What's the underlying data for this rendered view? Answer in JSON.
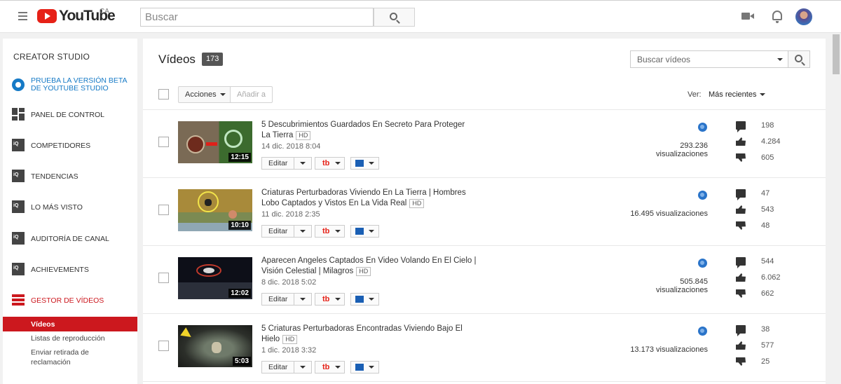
{
  "header": {
    "logo_text": "YouTube",
    "region": "CA",
    "search_placeholder": "Buscar"
  },
  "sidebar": {
    "title": "CREATOR STUDIO",
    "beta_line1": "PRUEBA LA VERSIÓN BETA",
    "beta_line2": "DE YOUTUBE STUDIO",
    "items": [
      {
        "label": "PANEL DE CONTROL",
        "icon": "dashboard-icon"
      },
      {
        "label": "COMPETIDORES",
        "icon": "iq-icon"
      },
      {
        "label": "TENDENCIAS",
        "icon": "iq-icon"
      },
      {
        "label": "LO MÁS VISTO",
        "icon": "iq-icon"
      },
      {
        "label": "AUDITORÍA DE CANAL",
        "icon": "iq-icon"
      },
      {
        "label": "ACHIEVEMENTS",
        "icon": "iq-icon"
      },
      {
        "label": "GESTOR DE VÍDEOS",
        "icon": "video-manager-icon"
      }
    ],
    "sub_items": [
      "Vídeos",
      "Listas de reproducción",
      "Enviar retirada de",
      "reclamación"
    ]
  },
  "main": {
    "title": "Vídeos",
    "count": "173",
    "search_placeholder": "Buscar vídeos",
    "actions_label": "Acciones",
    "add_to_label": "Añadir a",
    "sort_label": "Ver:",
    "sort_value": "Más recientes",
    "edit_label": "Editar",
    "tb_label": "tb",
    "videos": [
      {
        "title_line1": "5 Descubrimientos Guardados En Secreto Para Proteger",
        "title_line2": "La Tierra",
        "hd": "HD",
        "date": "14 dic. 2018 8:04",
        "duration": "12:15",
        "views": "293.236 visualizaciones",
        "comments": "198",
        "likes": "4.284",
        "dislikes": "605"
      },
      {
        "title_line1": "Criaturas Perturbadoras Viviendo En La Tierra | Hombres",
        "title_line2": "Lobo Captados y Vistos En La Vida Real",
        "hd": "HD",
        "date": "11 dic. 2018 2:35",
        "duration": "10:10",
        "views": "16.495 visualizaciones",
        "comments": "47",
        "likes": "543",
        "dislikes": "48"
      },
      {
        "title_line1": "Aparecen Angeles Captados En Video Volando En El Cielo |",
        "title_line2": "Visión Celestial | Milagros",
        "hd": "HD",
        "date": "8 dic. 2018 5:02",
        "duration": "12:02",
        "views": "505.845 visualizaciones",
        "comments": "544",
        "likes": "6.062",
        "dislikes": "662"
      },
      {
        "title_line1": "5 Criaturas Perturbadoras Encontradas Viviendo Bajo El",
        "title_line2": "Hielo",
        "hd": "HD",
        "date": "1 dic. 2018 3:32",
        "duration": "5:03",
        "views": "13.173 visualizaciones",
        "comments": "38",
        "likes": "577",
        "dislikes": "25"
      }
    ]
  }
}
